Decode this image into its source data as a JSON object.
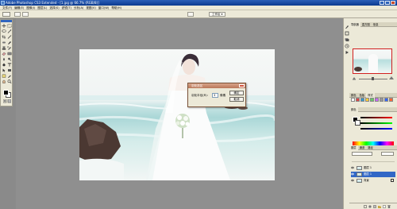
{
  "window": {
    "title": "Adobe Photoshop CS3 Extended - [1.jpg @ 66.7% (RGB/8)]",
    "app_icon": "photoshop-icon"
  },
  "menubar": {
    "items": [
      "文件(F)",
      "编辑(E)",
      "图像(I)",
      "图层(L)",
      "选择(S)",
      "滤镜(T)",
      "分析(A)",
      "视图(V)",
      "窗口(W)",
      "帮助(H)"
    ]
  },
  "optionsbar": {
    "workspace_label": "工作区 ▾"
  },
  "dialog": {
    "title": "羽化选区",
    "radius_label": "羽化半径(R):",
    "radius_value": "3",
    "unit": "像素",
    "ok_label": "确定",
    "cancel_label": "取消"
  },
  "panels": {
    "navigator_tabs": [
      "导航器",
      "直方图",
      "信息"
    ],
    "color_tabs": [
      "颜色",
      "色板",
      "样式"
    ],
    "layers_tabs": [
      "图层",
      "通道",
      "路径"
    ],
    "layers": [
      {
        "name": "图层 1",
        "selected": false
      },
      {
        "name": "图层 1",
        "selected": true
      },
      {
        "name": "背景",
        "selected": false
      }
    ]
  },
  "colors": {
    "titlebar": "#0b3a8f",
    "dialog_title": "#b9775a",
    "selection": "#3167c6",
    "navigator_frame": "#d12020"
  }
}
